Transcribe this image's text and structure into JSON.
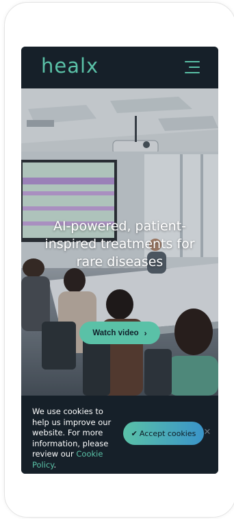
{
  "header": {
    "logo_text": "healx",
    "menu_icon": "hamburger-menu-icon"
  },
  "hero": {
    "title": "AI-powered, patient-inspired treatments for rare diseases",
    "watch_video_label": "Watch video",
    "watch_video_icon": "chevron-right-icon"
  },
  "cookie_banner": {
    "text": "We use cookies to help us improve our website. For more information, please review our",
    "link_label": "Cookie Policy",
    "after_link": ".",
    "accept_label": "Accept cookies",
    "accept_icon": "checkmark-icon",
    "close_icon": "close-icon"
  },
  "colors": {
    "brand_teal": "#5ac1a7",
    "dark_navy": "#162029",
    "accent_blue": "#3a94c9"
  }
}
